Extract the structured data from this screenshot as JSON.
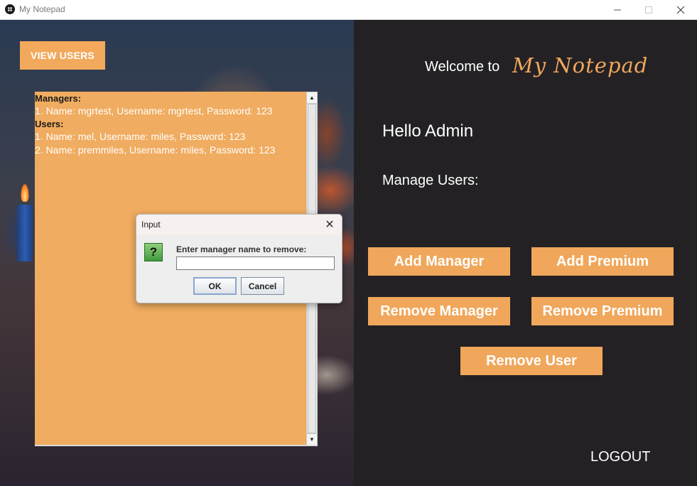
{
  "window": {
    "title": "My Notepad",
    "app_icon": "notepad-app-icon",
    "controls": {
      "minimize": "–",
      "maximize": "☐",
      "close": "✕"
    }
  },
  "left": {
    "view_users_label": "VIEW USERS",
    "users_list": [
      {
        "text": "Managers:",
        "kind": "heading"
      },
      {
        "text": "1. Name: mgrtest, Username: mgrtest, Password: 123",
        "kind": "item"
      },
      {
        "text": "Users:",
        "kind": "heading"
      },
      {
        "text": "1. Name: mel, Username: miles, Password: 123",
        "kind": "item"
      },
      {
        "text": "2. Name: premmiles, Username: miles, Password: 123",
        "kind": "item"
      }
    ],
    "scroll": {
      "up": "▲",
      "down": "▼"
    }
  },
  "right": {
    "welcome": "Welcome to",
    "brand": "My Notepad",
    "hello": "Hello Admin",
    "manage": "Manage Users:",
    "buttons": {
      "add_manager": "Add Manager",
      "add_premium": "Add Premium",
      "remove_manager": "Remove Manager",
      "remove_premium": "Remove Premium",
      "remove_user": "Remove User"
    },
    "logout": "LOGOUT"
  },
  "dialog": {
    "title": "Input",
    "close": "✕",
    "icon": "?",
    "prompt": "Enter manager name to remove:",
    "input_value": "",
    "ok": "OK",
    "cancel": "Cancel"
  },
  "colors": {
    "accent": "#f0a75b",
    "right_bg": "#232124",
    "text_area_bg": "#f0ac60"
  }
}
